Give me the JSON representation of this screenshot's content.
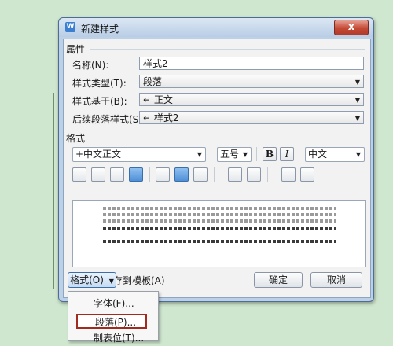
{
  "window": {
    "title": "新建样式",
    "close_glyph": "x"
  },
  "groups": {
    "properties": "属性",
    "format": "格式"
  },
  "fields": {
    "name": {
      "label": "名称(N):",
      "value": "样式2"
    },
    "type": {
      "label": "样式类型(T):",
      "value": "段落"
    },
    "based_on": {
      "label": "样式基于(B):",
      "value": "↵ 正文"
    },
    "next": {
      "label": "后续段落样式(S):",
      "value": "↵ 样式2"
    }
  },
  "toolbar": {
    "font": "+中文正文",
    "size": "五号",
    "bold": "B",
    "italic": "I",
    "lang": "中文"
  },
  "preview": {
    "prev_text": "前一段落前一段落前一段落前一段落前一段落前一段落前一段落前一段落前一段落",
    "sample_text": "文字实例文字实例文字实例文字实例文字实例文字实例文字实例文字实例"
  },
  "options": {
    "save_to_template": "同时保存到模板(A)"
  },
  "buttons": {
    "format": "格式(O)",
    "ok": "确定",
    "cancel": "取消"
  },
  "format_menu": {
    "items": [
      "字体(F)...",
      "段落(P)...",
      "制表位(T)..."
    ],
    "selected": "段落(P)..."
  },
  "icons": {
    "app": "wps-writer-icon"
  },
  "colors": {
    "background": "#cfe6cf",
    "selected_outline": "#a02b1e",
    "accent": "#3b7fd3"
  }
}
